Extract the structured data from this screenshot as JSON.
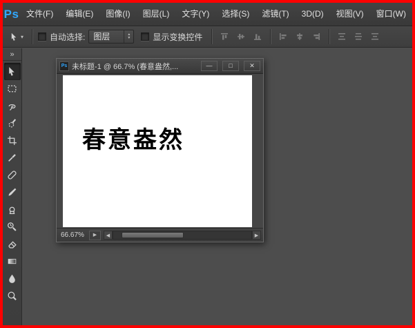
{
  "app": {
    "logo": "Ps",
    "menu_items": [
      "文件(F)",
      "编辑(E)",
      "图像(I)",
      "图层(L)",
      "文字(Y)",
      "选择(S)",
      "滤镜(T)",
      "3D(D)",
      "视图(V)",
      "窗口(W)"
    ]
  },
  "options_bar": {
    "auto_select_label": "自动选择:",
    "auto_select_value": "图层",
    "show_transform_label": "显示变换控件"
  },
  "toolbar": {
    "tools": [
      "移动工具",
      "矩形选框工具",
      "套索工具",
      "快速选择工具",
      "裁剪工具",
      "吸管工具",
      "污点修复画笔工具",
      "画笔工具",
      "仿制图章工具",
      "历史记录画笔工具",
      "橡皮擦工具",
      "渐变工具",
      "模糊工具",
      "减淡工具"
    ]
  },
  "document": {
    "icon_label": "Ps",
    "title": "未标题-1 @ 66.7% (春意盎然,...",
    "canvas_text": "春意盎然",
    "zoom": "66.67%"
  },
  "icons": {
    "collapse": "»",
    "preset_caret": "▾",
    "spinner_up": "▲",
    "spinner_down": "▼",
    "minimize": "—",
    "maximize": "□",
    "close": "✕",
    "scroll_left": "◀",
    "scroll_right": "▶",
    "status_flyout": "▶"
  },
  "colors": {
    "frame_red": "#fe0000",
    "ps_blue": "#31a8ff",
    "ui_dark": "#3f3f3f",
    "canvas_white": "#ffffff"
  }
}
